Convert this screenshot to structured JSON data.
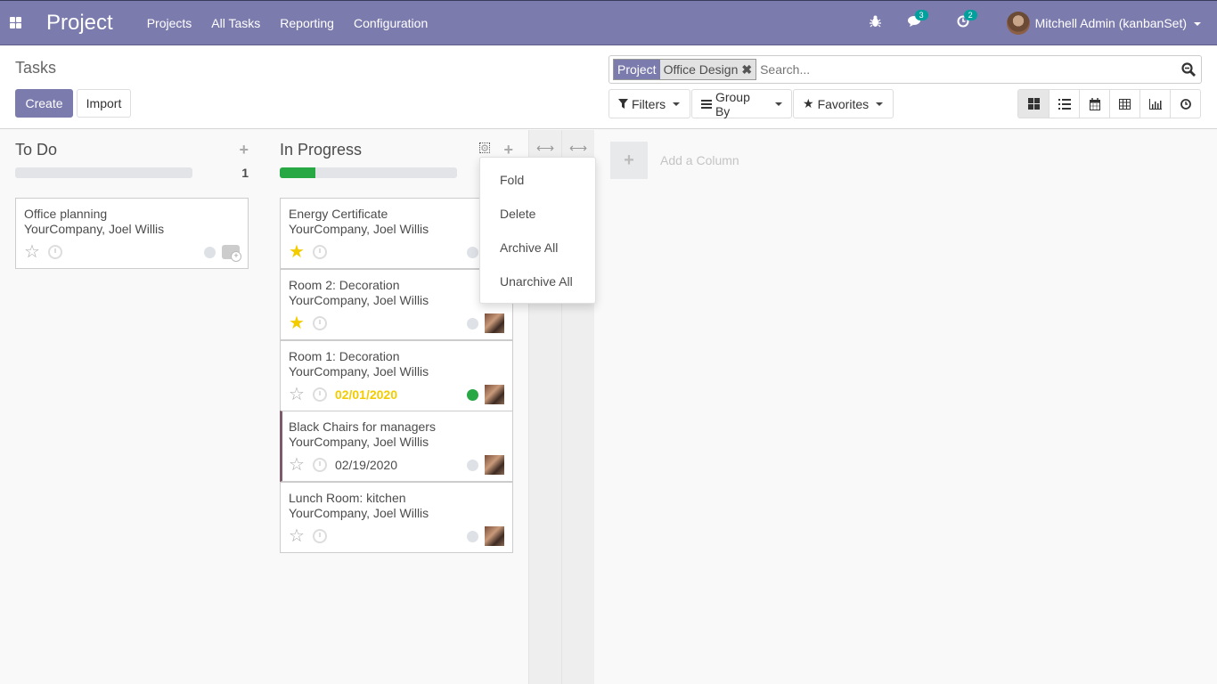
{
  "navbar": {
    "app_name": "Project",
    "menu": [
      "Projects",
      "All Tasks",
      "Reporting",
      "Configuration"
    ],
    "messages_count": "3",
    "activities_count": "2",
    "user_name": "Mitchell Admin (kanbanSet)",
    "icons": [
      "apps-icon",
      "bug-icon",
      "chat-icon",
      "clock-icon"
    ]
  },
  "control_panel": {
    "title": "Tasks",
    "create_label": "Create",
    "import_label": "Import",
    "search": {
      "facet_label": "Project",
      "facet_value": "Office Design",
      "facet_remove": "✖",
      "placeholder": "Search..."
    },
    "filters_label": "Filters",
    "groupby_label": "Group By",
    "favorites_label": "Favorites",
    "views": [
      "kanban",
      "list",
      "calendar",
      "pivot",
      "graph",
      "activity"
    ],
    "active_view": "kanban"
  },
  "kanban": {
    "columns": [
      {
        "title": "To Do",
        "count": "1",
        "progress_green": 0,
        "cards": [
          {
            "title": "Office planning",
            "subtitle": "YourCompany, Joel Willis",
            "starred": false,
            "deadline": "",
            "state": "normal",
            "has_avatar": false
          }
        ]
      },
      {
        "title": "In Progress",
        "count": "",
        "progress_green": 0.2,
        "cards": [
          {
            "title": "Energy Certificate",
            "subtitle": "YourCompany, Joel Willis",
            "starred": true,
            "deadline": "",
            "state": "normal",
            "has_avatar": true
          },
          {
            "title": "Room 2: Decoration",
            "subtitle": "YourCompany, Joel Willis",
            "starred": true,
            "deadline": "",
            "state": "normal",
            "has_avatar": true
          },
          {
            "title": "Room 1: Decoration",
            "subtitle": "YourCompany, Joel Willis",
            "starred": false,
            "deadline": "02/01/2020",
            "deadline_style": "warn",
            "state": "done",
            "has_avatar": true
          },
          {
            "title": "Black Chairs for managers",
            "subtitle": "YourCompany, Joel Willis",
            "starred": false,
            "deadline": "02/19/2020",
            "deadline_style": "normal",
            "state": "normal",
            "has_avatar": true,
            "color_bar": "#7c5a6a"
          },
          {
            "title": "Lunch Room: kitchen",
            "subtitle": "YourCompany, Joel Willis",
            "starred": false,
            "deadline": "",
            "state": "normal",
            "has_avatar": true
          }
        ]
      }
    ],
    "folded_columns": 2,
    "add_column_label": "Add a Column",
    "column_menu": [
      "Fold",
      "Delete",
      "Archive All",
      "Unarchive All"
    ]
  },
  "colors": {
    "brand": "#7c7bad",
    "badge": "#00a09d",
    "success": "#28a745",
    "warning": "#f3cc00"
  }
}
